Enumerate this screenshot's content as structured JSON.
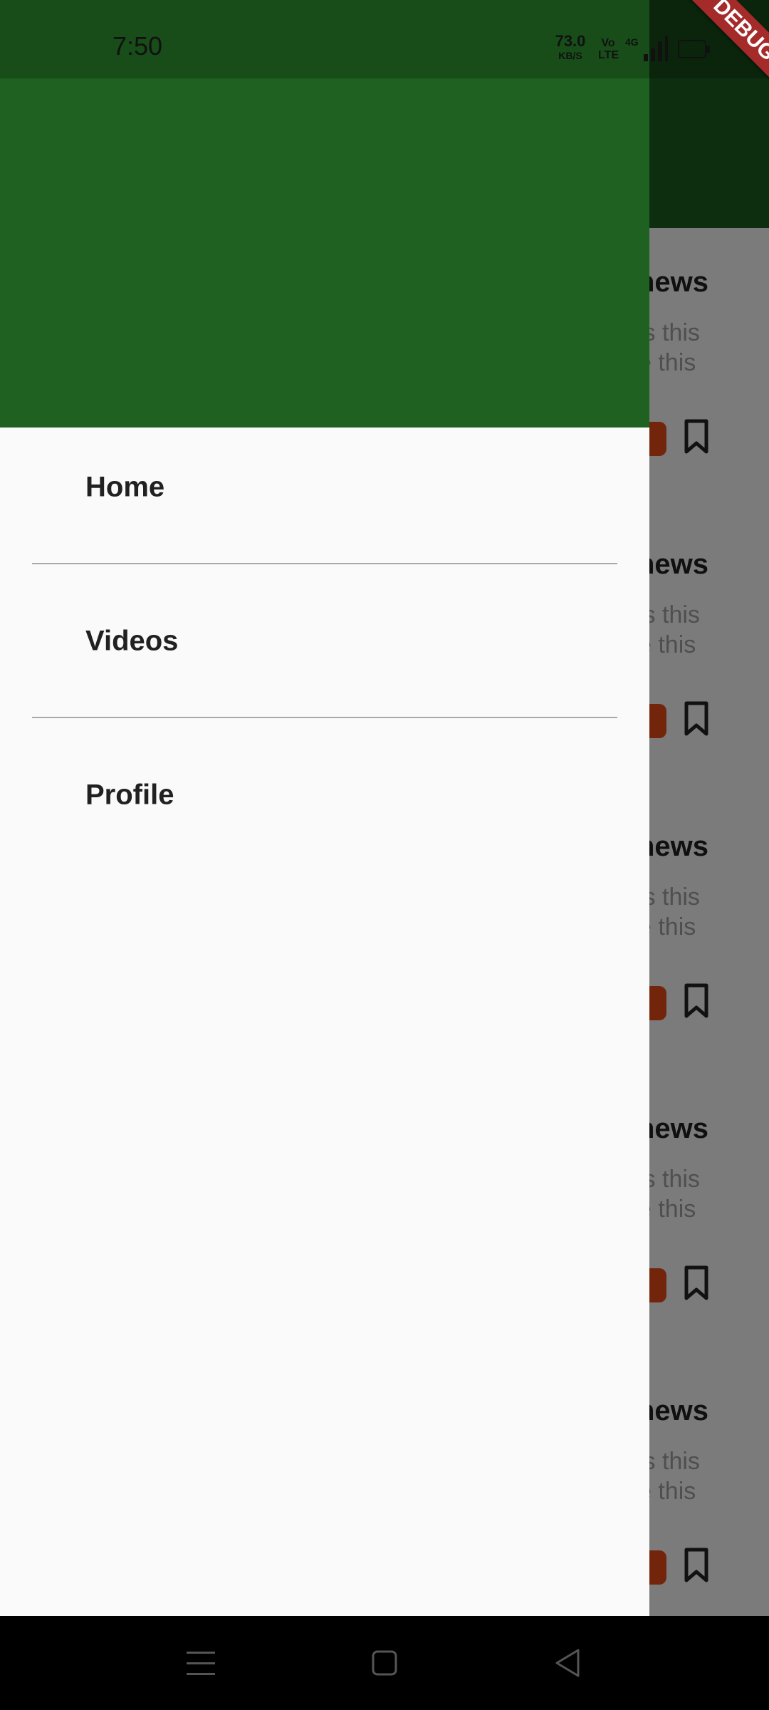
{
  "status_bar": {
    "time": "7:50",
    "net_speed_value": "73.0",
    "net_speed_unit": "KB/S",
    "volte_top": "Vo",
    "volte_bottom": "LTE",
    "network": "4G"
  },
  "debug_banner": {
    "label": "DEBUG"
  },
  "drawer": {
    "header_color": "#1e6121",
    "items": [
      {
        "label": "Home"
      },
      {
        "label": "Videos"
      },
      {
        "label": "Profile"
      }
    ]
  },
  "background_feed": {
    "app_bar_color": "#1b5e20",
    "cards": [
      {
        "title": "news",
        "body_line1": "is this",
        "body_line2": "e this"
      },
      {
        "title": "news",
        "body_line1": "is this",
        "body_line2": "e this"
      },
      {
        "title": "news",
        "body_line1": "is this",
        "body_line2": "e this"
      },
      {
        "title": "news",
        "body_line1": "is this",
        "body_line2": "e this"
      },
      {
        "title": "news",
        "body_line1": "is this",
        "body_line2": "e this"
      }
    ]
  },
  "nav_bar": {
    "icons": [
      "menu-icon",
      "home-square-icon",
      "back-triangle-icon"
    ]
  }
}
